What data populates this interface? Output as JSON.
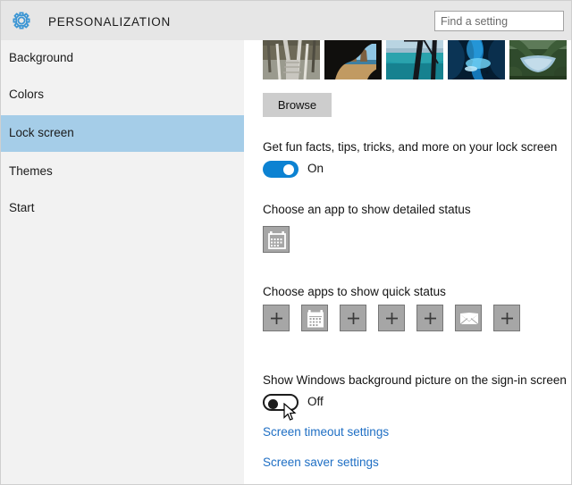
{
  "window": {
    "title": "PERSONALIZATION",
    "gear_icon": "gear-icon"
  },
  "search": {
    "placeholder": "Find a setting",
    "value": "",
    "icon": "search-icon"
  },
  "sidebar": {
    "items": [
      {
        "label": "Background",
        "selected": false
      },
      {
        "label": "Colors",
        "selected": false
      },
      {
        "label": "Lock screen",
        "selected": true
      },
      {
        "label": "Themes",
        "selected": false
      },
      {
        "label": "Start",
        "selected": false
      }
    ],
    "selected_color": "#a5cde8",
    "background_color": "#f2f2f2"
  },
  "main": {
    "thumbnails": [
      {
        "name": "boardwalk-stairs-thumbnail"
      },
      {
        "name": "beach-cave-thumbnail"
      },
      {
        "name": "aerial-coast-thumbnail"
      },
      {
        "name": "ice-cave-thumbnail"
      },
      {
        "name": "mountain-lake-thumbnail"
      }
    ],
    "browse_label": "Browse",
    "fun_facts": {
      "label": "Get fun facts, tips, tricks, and more on your lock screen",
      "state": "On",
      "on": true
    },
    "detailed_status": {
      "label": "Choose an app to show detailed status",
      "tiles": [
        {
          "icon": "calendar-icon"
        }
      ]
    },
    "quick_status": {
      "label": "Choose apps to show quick status",
      "tiles": [
        {
          "icon": "plus-icon"
        },
        {
          "icon": "calendar-icon"
        },
        {
          "icon": "plus-icon"
        },
        {
          "icon": "plus-icon"
        },
        {
          "icon": "plus-icon"
        },
        {
          "icon": "mail-icon"
        },
        {
          "icon": "plus-icon"
        }
      ]
    },
    "signin_picture": {
      "label": "Show Windows background picture on the sign-in screen",
      "state": "Off",
      "on": false
    },
    "links": [
      {
        "label": "Screen timeout settings"
      },
      {
        "label": "Screen saver settings"
      }
    ]
  },
  "colors": {
    "accent_blue": "#0c82d2",
    "link_blue": "#1f6fc4",
    "header_gray": "#e6e6e6",
    "tile_gray": "#a6a6a6",
    "button_gray": "#cdcdcd"
  }
}
